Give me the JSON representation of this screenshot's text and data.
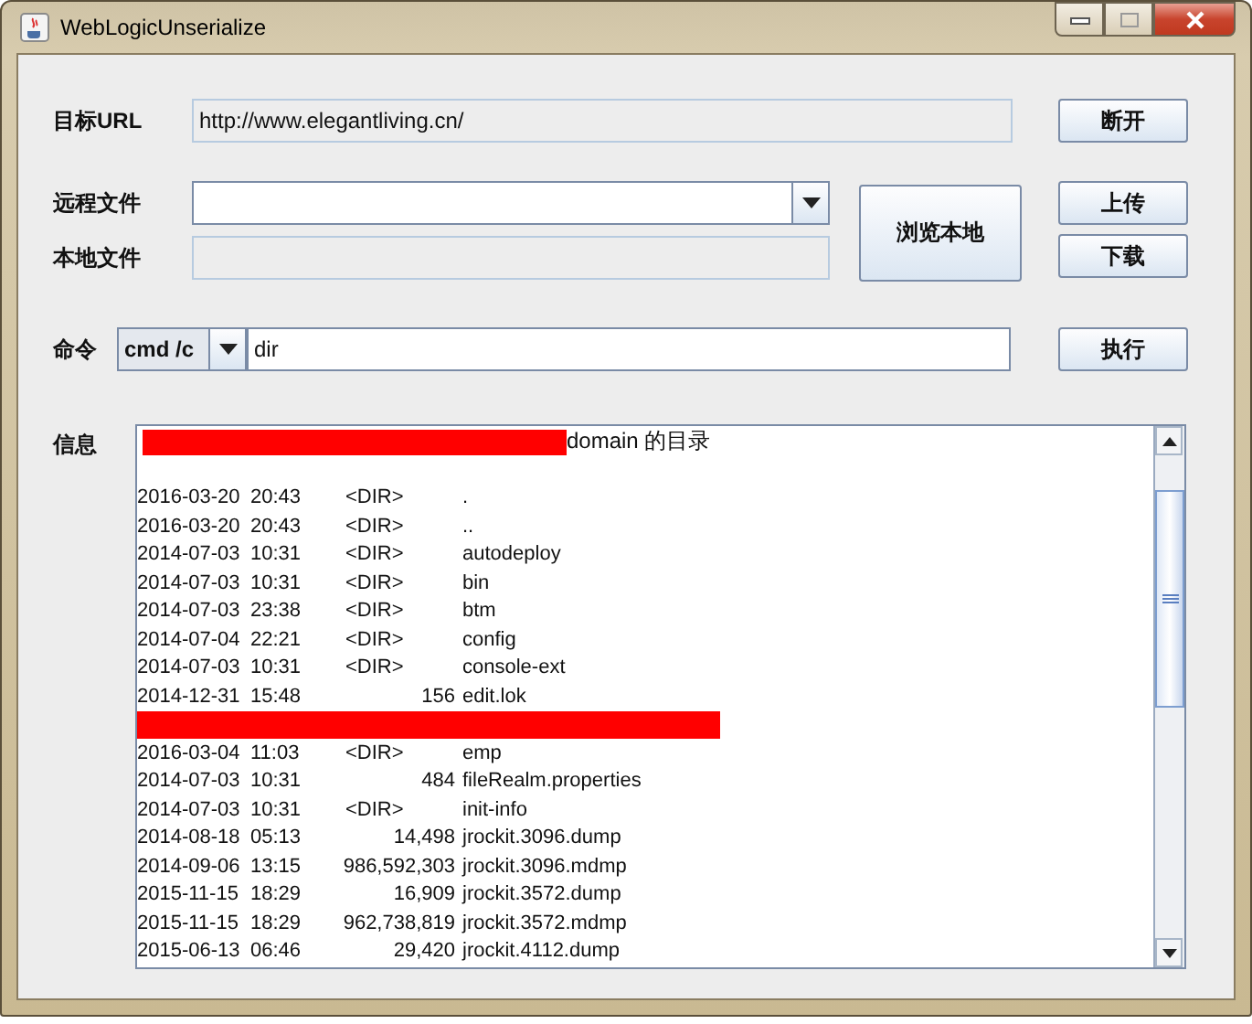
{
  "window": {
    "title": "WebLogicUnserialize"
  },
  "target": {
    "label": "目标URL",
    "value": "http://www.elegantliving.cn/",
    "button": "断开"
  },
  "remote_file": {
    "label": "远程文件"
  },
  "local_file": {
    "label": "本地文件"
  },
  "browse_button": "浏览本地",
  "upload_button": "上传",
  "download_button": "下载",
  "command": {
    "label": "命令",
    "shell": "cmd /c",
    "value": "dir",
    "button": "执行"
  },
  "info": {
    "label": "信息",
    "lines": [
      {
        "kind": "header",
        "text": "domain 的目录"
      },
      {
        "kind": "blank"
      },
      {
        "kind": "dir",
        "date": "2016-03-20",
        "time": "20:43",
        "size": "<DIR>",
        "name": "."
      },
      {
        "kind": "dir",
        "date": "2016-03-20",
        "time": "20:43",
        "size": "<DIR>",
        "name": ".."
      },
      {
        "kind": "dir",
        "date": "2014-07-03",
        "time": "10:31",
        "size": "<DIR>",
        "name": "autodeploy"
      },
      {
        "kind": "dir",
        "date": "2014-07-03",
        "time": "10:31",
        "size": "<DIR>",
        "name": "bin"
      },
      {
        "kind": "dir",
        "date": "2014-07-03",
        "time": "23:38",
        "size": "<DIR>",
        "name": "btm"
      },
      {
        "kind": "dir",
        "date": "2014-07-04",
        "time": "22:21",
        "size": "<DIR>",
        "name": "config"
      },
      {
        "kind": "dir",
        "date": "2014-07-03",
        "time": "10:31",
        "size": "<DIR>",
        "name": "console-ext"
      },
      {
        "kind": "file",
        "date": "2014-12-31",
        "time": "15:48",
        "size": "156",
        "name": "edit.lok"
      },
      {
        "kind": "redacted"
      },
      {
        "kind": "dir",
        "date": "2016-03-04",
        "time": "11:03",
        "size": "<DIR>",
        "name": "emp"
      },
      {
        "kind": "file",
        "date": "2014-07-03",
        "time": "10:31",
        "size": "484",
        "name": "fileRealm.properties"
      },
      {
        "kind": "dir",
        "date": "2014-07-03",
        "time": "10:31",
        "size": "<DIR>",
        "name": "init-info"
      },
      {
        "kind": "file",
        "date": "2014-08-18",
        "time": "05:13",
        "size": "14,498",
        "name": "jrockit.3096.dump"
      },
      {
        "kind": "file",
        "date": "2014-09-06",
        "time": "13:15",
        "size": "986,592,303",
        "name": "jrockit.3096.mdmp"
      },
      {
        "kind": "file",
        "date": "2015-11-15",
        "time": "18:29",
        "size": "16,909",
        "name": "jrockit.3572.dump"
      },
      {
        "kind": "file",
        "date": "2015-11-15",
        "time": "18:29",
        "size": "962,738,819",
        "name": "jrockit.3572.mdmp"
      },
      {
        "kind": "file",
        "date": "2015-06-13",
        "time": "06:46",
        "size": "29,420",
        "name": "jrockit.4112.dump"
      }
    ]
  }
}
